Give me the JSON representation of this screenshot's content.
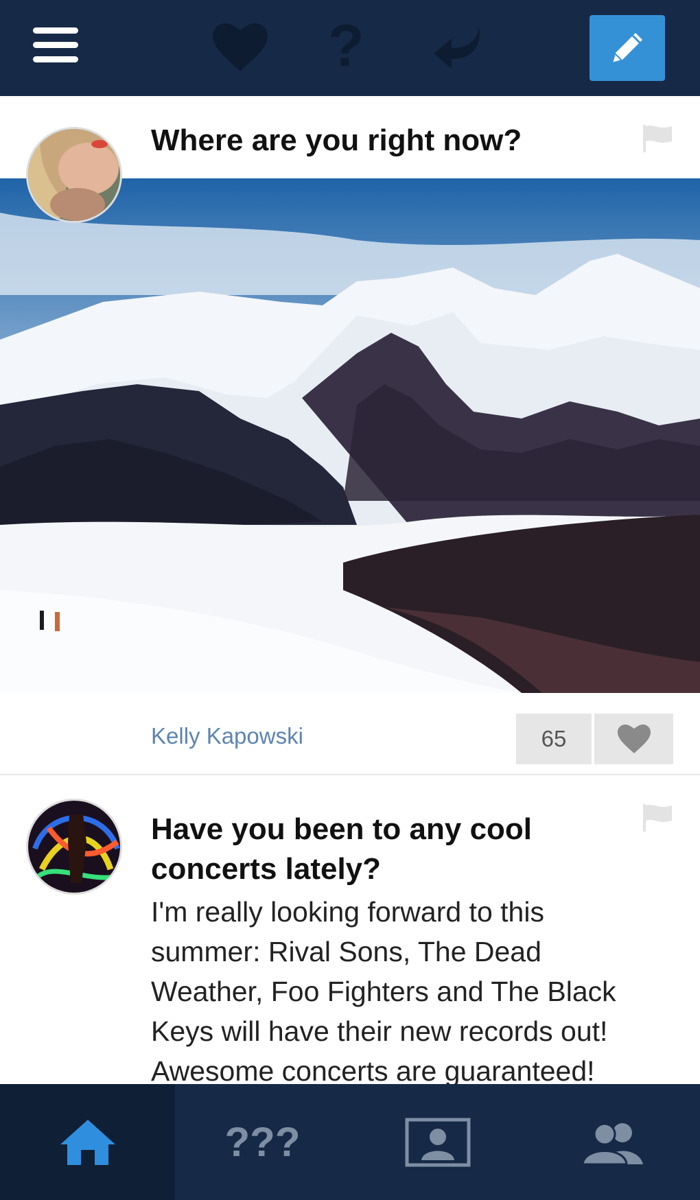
{
  "topbar": {
    "menu_icon": "hamburger-menu-icon",
    "heart_icon": "heart-icon",
    "help_icon": "question-mark-icon",
    "help_glyph": "?",
    "reply_icon": "reply-arrow-icon",
    "compose_icon": "pencil-icon",
    "compose_color": "#3591d6"
  },
  "posts": [
    {
      "title": "Where are you right now?",
      "author": "Kelly Kapowski",
      "likes": "65",
      "image": "snowy-mountain-landscape"
    },
    {
      "title": "Have you been to any cool concerts lately?",
      "body": "I'm really looking forward to this summer: Rival Sons, The Dead Weather, Foo Fighters and The Black Keys will have their new records out! Awesome concerts are guaranteed!"
    }
  ],
  "tabbar": {
    "home_icon": "home-icon",
    "questions_label": "???",
    "profile_icon": "profile-card-icon",
    "friends_icon": "friends-icon",
    "active_color": "#2f8fde"
  },
  "colors": {
    "navbar": "#162a47",
    "author_link": "#5d84b3"
  }
}
